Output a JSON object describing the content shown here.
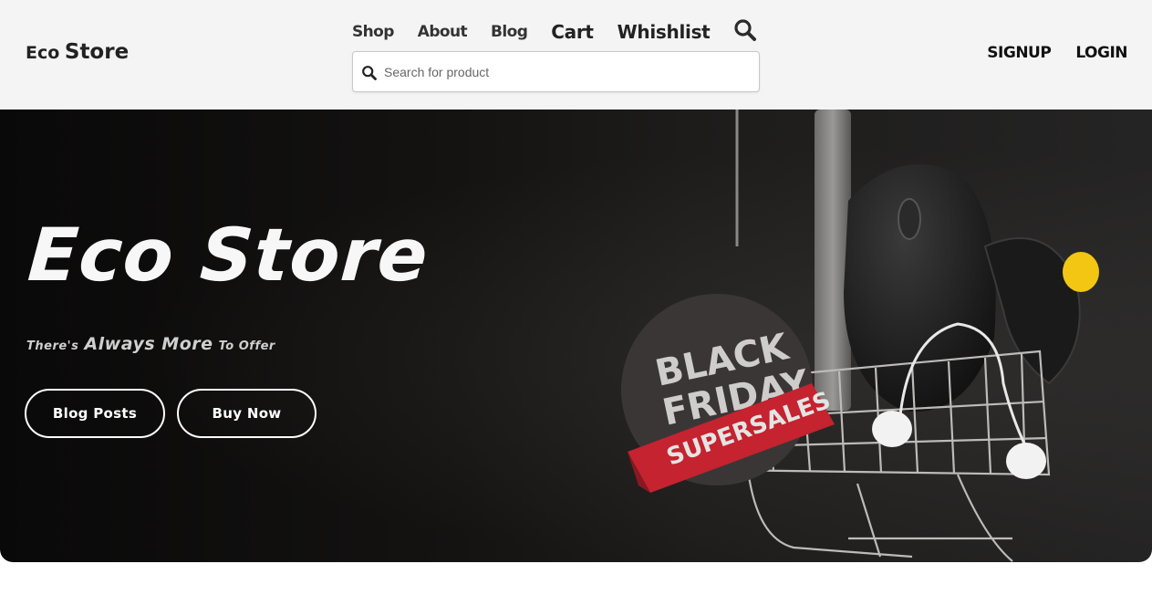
{
  "brand": {
    "part1": "Eco",
    "part2": "Store"
  },
  "nav": {
    "shop": "Shop",
    "about": "About",
    "blog": "Blog",
    "cart": "Cart",
    "wishlist": "Whishlist",
    "search_icon": "search-icon"
  },
  "search": {
    "placeholder": "Search for product",
    "value": "",
    "icon": "search-icon"
  },
  "auth": {
    "signup": "SIGNUP",
    "login": "LOGIN"
  },
  "hero": {
    "title": "Eco Store",
    "tagline": {
      "part1": "There's",
      "part2": "Always More",
      "part3": "To Offer"
    },
    "buttons": {
      "blog_posts": "Blog Posts",
      "buy_now": "Buy Now"
    },
    "badge": {
      "line1": "BLACK",
      "line2": "FRIDAY",
      "ribbon": "SUPERSALES"
    }
  },
  "colors": {
    "navbar_bg": "#f4f4f4",
    "hero_bg": "#141312",
    "button_border": "#ffffff",
    "ribbon_red": "#c4232f",
    "badge_dark": "#3b3636",
    "accent_yellow": "#f3c613"
  }
}
